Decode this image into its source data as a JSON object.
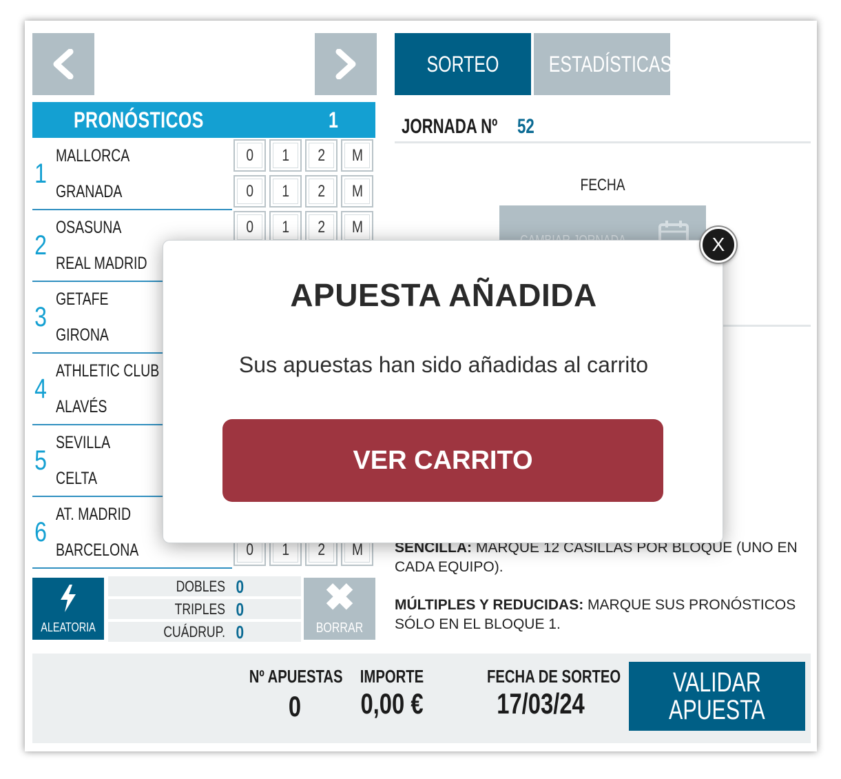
{
  "nav": {
    "prev_icon": "chevron-left-icon",
    "next_icon": "chevron-right-icon"
  },
  "tabs": [
    {
      "label": "SORTEO",
      "active": true,
      "color": "#005f86"
    },
    {
      "label": "ESTADÍSTICAS",
      "active": false,
      "color": "#b0bec5"
    }
  ],
  "pronosticos": {
    "title": "PRONÓSTICOS",
    "block": "1"
  },
  "options": [
    "0",
    "1",
    "2",
    "M"
  ],
  "matches": [
    {
      "num": "1",
      "home": "MALLORCA",
      "away": "GRANADA"
    },
    {
      "num": "2",
      "home": "OSASUNA",
      "away": "REAL MADRID"
    },
    {
      "num": "3",
      "home": "GETAFE",
      "away": "GIRONA"
    },
    {
      "num": "4",
      "home": "ATHLETIC CLUB",
      "away": "ALAVÉS"
    },
    {
      "num": "5",
      "home": "SEVILLA",
      "away": "CELTA"
    },
    {
      "num": "6",
      "home": "AT. MADRID",
      "away": "BARCELONA"
    }
  ],
  "controls": {
    "aleatoria_label": "ALEATORIA",
    "borrar_label": "BORRAR",
    "dobles_label": "DOBLES",
    "dobles_value": "0",
    "triples_label": "TRIPLES",
    "triples_value": "0",
    "cuadruples_label": "CUÁDRUP.",
    "cuadruples_value": "0"
  },
  "jornada": {
    "label": "JORNADA Nº",
    "value": "52"
  },
  "fecha": {
    "label": "FECHA",
    "cambiar_label": "CAMBIAR JORNADA"
  },
  "info": {
    "sencilla_title": "SENCILLA:",
    "sencilla_text": " MARQUE 12 CASILLAS POR BLOQUE (UNO EN CADA EQUIPO).",
    "multiples_title": "MÚLTIPLES Y REDUCIDAS:",
    "multiples_text": " MARQUE SUS PRONÓSTICOS SÓLO EN EL BLOQUE 1."
  },
  "footer": {
    "apuestas_label": "Nº APUESTAS",
    "apuestas_value": "0",
    "importe_label": "IMPORTE",
    "importe_value": "0,00 €",
    "fecha_label": "FECHA DE SORTEO",
    "fecha_value": "17/03/24",
    "validar_line1": "VALIDAR",
    "validar_line2": "APUESTA"
  },
  "modal": {
    "title": "APUESTA AÑADIDA",
    "message": "Sus apuestas han sido añadidas al carrito",
    "button": "VER CARRITO",
    "close": "X"
  },
  "colors": {
    "accent_blue": "#14a0d2",
    "dark_blue": "#005f86",
    "grey": "#b0bec5",
    "cart_red": "#9e3540"
  }
}
